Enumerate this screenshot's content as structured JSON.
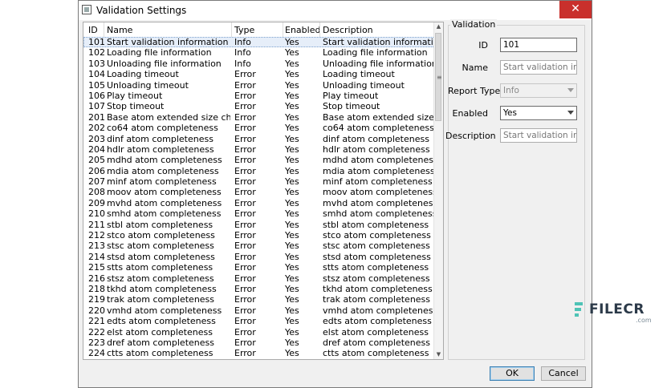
{
  "window": {
    "title": "Validation Settings",
    "close_glyph": "✕"
  },
  "table": {
    "headers": [
      "ID",
      "Name",
      "Type",
      "Enabled",
      "Description"
    ],
    "selected_index": 0,
    "rows": [
      [
        "101",
        "Start validation information",
        "Info",
        "Yes",
        "Start validation information"
      ],
      [
        "102",
        "Loading file information",
        "Info",
        "Yes",
        "Loading file information"
      ],
      [
        "103",
        "Unloading file information",
        "Info",
        "Yes",
        "Unloading file information"
      ],
      [
        "104",
        "Loading timeout",
        "Error",
        "Yes",
        "Loading timeout"
      ],
      [
        "105",
        "Unloading timeout",
        "Error",
        "Yes",
        "Unloading timeout"
      ],
      [
        "106",
        "Play timeout",
        "Error",
        "Yes",
        "Play timeout"
      ],
      [
        "107",
        "Stop timeout",
        "Error",
        "Yes",
        "Stop timeout"
      ],
      [
        "201",
        "Base atom extended size check",
        "Error",
        "Yes",
        "Base atom extended size check"
      ],
      [
        "202",
        "co64 atom completeness",
        "Error",
        "Yes",
        "co64 atom completeness"
      ],
      [
        "203",
        "dinf atom completeness",
        "Error",
        "Yes",
        "dinf atom completeness"
      ],
      [
        "204",
        "hdlr atom completeness",
        "Error",
        "Yes",
        "hdlr atom completeness"
      ],
      [
        "205",
        "mdhd atom completeness",
        "Error",
        "Yes",
        "mdhd atom completeness"
      ],
      [
        "206",
        "mdia atom completeness",
        "Error",
        "Yes",
        "mdia atom completeness"
      ],
      [
        "207",
        "minf atom completeness",
        "Error",
        "Yes",
        "minf atom completeness"
      ],
      [
        "208",
        "moov atom completeness",
        "Error",
        "Yes",
        "moov atom completeness"
      ],
      [
        "209",
        "mvhd atom completeness",
        "Error",
        "Yes",
        "mvhd atom completeness"
      ],
      [
        "210",
        "smhd atom completeness",
        "Error",
        "Yes",
        "smhd atom completeness"
      ],
      [
        "211",
        "stbl atom completeness",
        "Error",
        "Yes",
        "stbl atom completeness"
      ],
      [
        "212",
        "stco atom completeness",
        "Error",
        "Yes",
        "stco atom completeness"
      ],
      [
        "213",
        "stsc atom completeness",
        "Error",
        "Yes",
        "stsc atom completeness"
      ],
      [
        "214",
        "stsd atom completeness",
        "Error",
        "Yes",
        "stsd atom completeness"
      ],
      [
        "215",
        "stts atom completeness",
        "Error",
        "Yes",
        "stts atom completeness"
      ],
      [
        "216",
        "stsz atom completeness",
        "Error",
        "Yes",
        "stsz atom completeness"
      ],
      [
        "218",
        "tkhd atom completeness",
        "Error",
        "Yes",
        "tkhd atom completeness"
      ],
      [
        "219",
        "trak atom completeness",
        "Error",
        "Yes",
        "trak atom completeness"
      ],
      [
        "220",
        "vmhd atom completeness",
        "Error",
        "Yes",
        "vmhd atom completeness"
      ],
      [
        "221",
        "edts atom completeness",
        "Error",
        "Yes",
        "edts atom completeness"
      ],
      [
        "222",
        "elst atom completeness",
        "Error",
        "Yes",
        "elst atom completeness"
      ],
      [
        "223",
        "dref atom completeness",
        "Error",
        "Yes",
        "dref atom completeness"
      ],
      [
        "224",
        "ctts atom completeness",
        "Error",
        "Yes",
        "ctts atom completeness"
      ]
    ]
  },
  "scrollbar": {
    "up_glyph": "▲",
    "down_glyph": "▼",
    "grip_glyph": "≡"
  },
  "validation": {
    "group_title": "Validation",
    "id_label": "ID",
    "id_value": "101",
    "name_label": "Name",
    "name_value": "Start validation information",
    "report_type_label": "Report Type",
    "report_type_value": "Info",
    "enabled_label": "Enabled",
    "enabled_value": "Yes",
    "description_label": "Description",
    "description_value": "Start validation information"
  },
  "buttons": {
    "ok": "OK",
    "cancel": "Cancel"
  },
  "watermark": {
    "text": "FILECR",
    "sub": ".com"
  }
}
